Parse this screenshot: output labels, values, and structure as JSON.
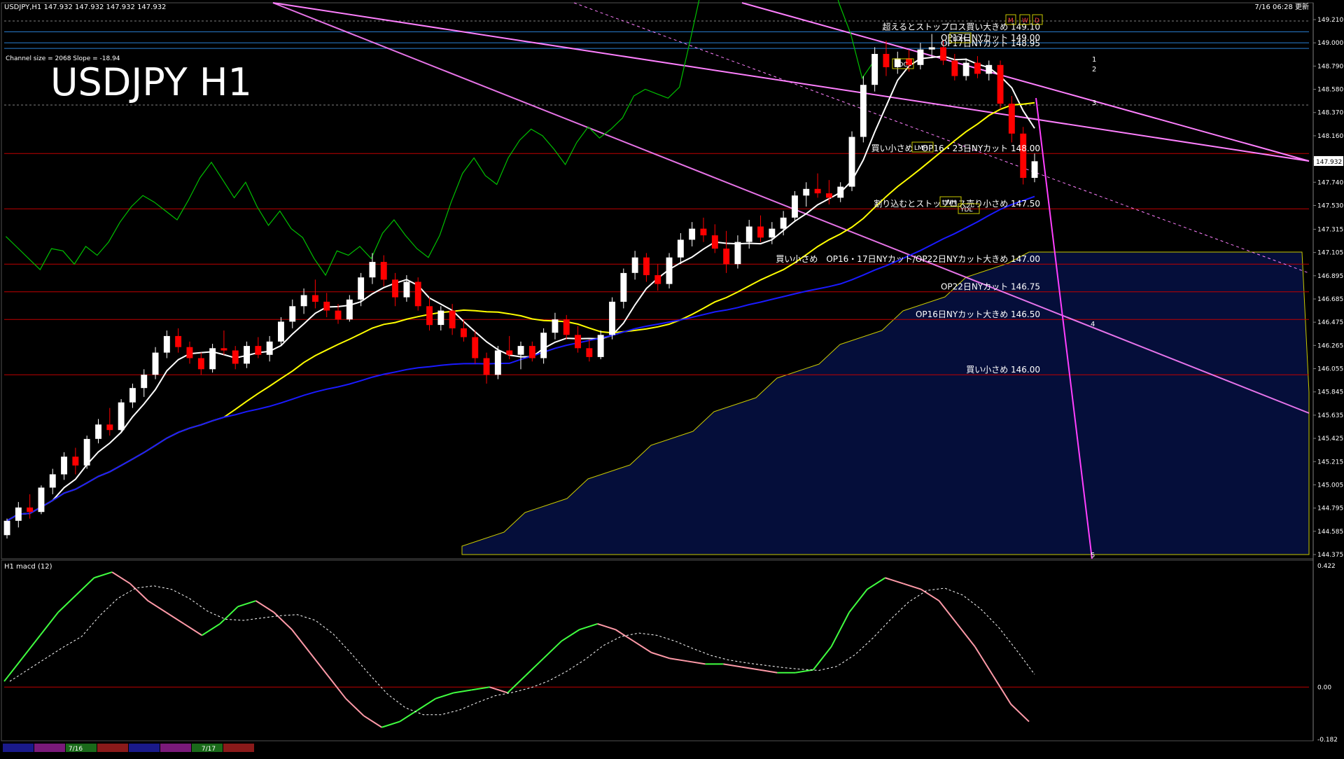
{
  "header": {
    "symbol_line": "USDJPY,H1  147.932 147.932 147.932 147.932",
    "updated": "7/16 06:28 更新",
    "channel_info": "Channel size = 2068 Slope = -18.94",
    "big_title": "USDJPY H1"
  },
  "colors": {
    "background": "#000000",
    "bull_candle": "#ffffff",
    "bear_candle": "#ff0000",
    "ma_fast": "#ffffff",
    "ma_mid": "#ffff00",
    "ma_slow": "#1a1aff",
    "chikou": "#00c000",
    "channel": "#ff80ff",
    "level_line": "#c00000",
    "macd_up": "#40ff40",
    "macd_down": "#ff9aa8"
  },
  "chart_data": {
    "type": "line",
    "symbol": "USDJPY",
    "timeframe": "H1",
    "ylim": [
      144.375,
      149.21
    ],
    "y_ticks": [
      "149.210",
      "149.000",
      "148.790",
      "148.580",
      "148.370",
      "148.160",
      "147.950",
      "147.740",
      "147.530",
      "147.315",
      "147.105",
      "146.895",
      "146.685",
      "146.475",
      "146.265",
      "146.055",
      "145.845",
      "145.635",
      "145.425",
      "145.215",
      "145.005",
      "144.795",
      "144.585",
      "144.375"
    ],
    "current_price": "147.932",
    "x_labels": [
      "7/16",
      "7/17"
    ],
    "annotations": [
      {
        "text": "超えるとストップロス買い大きめ 149.10",
        "price": 149.1
      },
      {
        "text": "OP17日NYカット 149.00",
        "price": 149.0
      },
      {
        "text": "OP17日NYカット 148.95",
        "price": 148.95
      },
      {
        "text": "買い小さめ　OP16・23日NYカット 148.00",
        "price": 148.0
      },
      {
        "text": "割り込むとストップロス売り小さめ 147.50",
        "price": 147.5
      },
      {
        "text": "買い小さめ　OP16・17日NYカット/OP22日NYカット大きめ 147.00",
        "price": 147.0
      },
      {
        "text": "OP22日NYカット 146.75",
        "price": 146.75
      },
      {
        "text": "OP16日NYカット大きめ 146.50",
        "price": 146.5
      },
      {
        "text": "買い小さめ 146.00",
        "price": 146.0
      }
    ],
    "level_lines": [
      149.1,
      149.0,
      148.95,
      148.0,
      147.5,
      147.0,
      146.75,
      146.5,
      146.0
    ],
    "markers": [
      "YDC",
      "YDH",
      "YDL",
      "LWH",
      "LMH",
      "M",
      "W",
      "D"
    ],
    "projection_labels": [
      "1",
      "2",
      "3",
      "4",
      "5"
    ],
    "candles": [
      [
        144.55,
        144.7,
        144.52,
        144.68
      ],
      [
        144.68,
        144.85,
        144.62,
        144.8
      ],
      [
        144.8,
        144.92,
        144.7,
        144.76
      ],
      [
        144.76,
        145.0,
        144.74,
        144.98
      ],
      [
        144.98,
        145.15,
        144.92,
        145.1
      ],
      [
        145.1,
        145.3,
        145.05,
        145.26
      ],
      [
        145.26,
        145.34,
        145.1,
        145.18
      ],
      [
        145.18,
        145.45,
        145.15,
        145.42
      ],
      [
        145.42,
        145.6,
        145.38,
        145.55
      ],
      [
        145.55,
        145.7,
        145.45,
        145.5
      ],
      [
        145.5,
        145.78,
        145.48,
        145.75
      ],
      [
        145.75,
        145.92,
        145.7,
        145.88
      ],
      [
        145.88,
        146.05,
        145.8,
        146.0
      ],
      [
        146.0,
        146.25,
        145.96,
        146.2
      ],
      [
        146.2,
        146.4,
        146.15,
        146.35
      ],
      [
        146.35,
        146.42,
        146.2,
        146.25
      ],
      [
        146.25,
        146.3,
        146.1,
        146.15
      ],
      [
        146.15,
        146.2,
        146.0,
        146.05
      ],
      [
        146.05,
        146.28,
        146.02,
        146.24
      ],
      [
        146.24,
        146.4,
        146.18,
        146.22
      ],
      [
        146.22,
        146.26,
        146.05,
        146.1
      ],
      [
        146.1,
        146.3,
        146.06,
        146.26
      ],
      [
        146.26,
        146.34,
        146.15,
        146.18
      ],
      [
        146.18,
        146.35,
        146.12,
        146.3
      ],
      [
        146.3,
        146.52,
        146.26,
        146.48
      ],
      [
        146.48,
        146.68,
        146.42,
        146.62
      ],
      [
        146.62,
        146.78,
        146.55,
        146.72
      ],
      [
        146.72,
        146.86,
        146.6,
        146.66
      ],
      [
        146.66,
        146.74,
        146.52,
        146.58
      ],
      [
        146.58,
        146.64,
        146.46,
        146.5
      ],
      [
        146.5,
        146.72,
        146.48,
        146.68
      ],
      [
        146.68,
        146.92,
        146.62,
        146.88
      ],
      [
        146.88,
        147.1,
        146.82,
        147.02
      ],
      [
        147.02,
        147.08,
        146.8,
        146.86
      ],
      [
        146.86,
        146.92,
        146.62,
        146.7
      ],
      [
        146.7,
        146.9,
        146.66,
        146.84
      ],
      [
        146.84,
        146.88,
        146.58,
        146.62
      ],
      [
        146.62,
        146.7,
        146.4,
        146.45
      ],
      [
        146.45,
        146.62,
        146.4,
        146.58
      ],
      [
        146.58,
        146.64,
        146.36,
        146.42
      ],
      [
        146.42,
        146.5,
        146.3,
        146.34
      ],
      [
        146.34,
        146.4,
        146.1,
        146.15
      ],
      [
        146.15,
        146.2,
        145.92,
        146.0
      ],
      [
        146.0,
        146.26,
        145.96,
        146.22
      ],
      [
        146.22,
        146.35,
        146.14,
        146.18
      ],
      [
        146.18,
        146.3,
        146.05,
        146.26
      ],
      [
        146.26,
        146.3,
        146.12,
        146.15
      ],
      [
        146.15,
        146.42,
        146.1,
        146.38
      ],
      [
        146.38,
        146.56,
        146.32,
        146.5
      ],
      [
        146.5,
        146.54,
        146.32,
        146.36
      ],
      [
        146.36,
        146.44,
        146.2,
        146.24
      ],
      [
        146.24,
        146.32,
        146.12,
        146.16
      ],
      [
        146.16,
        146.4,
        146.14,
        146.36
      ],
      [
        146.36,
        146.7,
        146.32,
        146.66
      ],
      [
        146.66,
        146.96,
        146.6,
        146.92
      ],
      [
        146.92,
        147.12,
        146.86,
        147.06
      ],
      [
        147.06,
        147.1,
        146.84,
        146.9
      ],
      [
        146.9,
        147.0,
        146.76,
        146.82
      ],
      [
        146.82,
        147.1,
        146.78,
        147.06
      ],
      [
        147.06,
        147.28,
        147.0,
        147.22
      ],
      [
        147.22,
        147.38,
        147.16,
        147.32
      ],
      [
        147.32,
        147.42,
        147.2,
        147.26
      ],
      [
        147.26,
        147.36,
        147.1,
        147.14
      ],
      [
        147.14,
        147.3,
        146.92,
        147.0
      ],
      [
        147.0,
        147.26,
        146.96,
        147.2
      ],
      [
        147.2,
        147.4,
        147.14,
        147.34
      ],
      [
        147.34,
        147.44,
        147.2,
        147.24
      ],
      [
        147.24,
        147.38,
        147.18,
        147.32
      ],
      [
        147.32,
        147.48,
        147.26,
        147.42
      ],
      [
        147.42,
        147.66,
        147.38,
        147.62
      ],
      [
        147.62,
        147.74,
        147.52,
        147.68
      ],
      [
        147.68,
        147.82,
        147.6,
        147.64
      ],
      [
        147.64,
        147.76,
        147.54,
        147.6
      ],
      [
        147.6,
        147.74,
        147.56,
        147.7
      ],
      [
        147.7,
        148.2,
        147.66,
        148.15
      ],
      [
        148.15,
        148.7,
        148.1,
        148.62
      ],
      [
        148.62,
        148.96,
        148.56,
        148.9
      ],
      [
        148.9,
        149.02,
        148.7,
        148.78
      ],
      [
        148.78,
        148.92,
        148.72,
        148.86
      ],
      [
        148.86,
        148.94,
        148.74,
        148.8
      ],
      [
        148.8,
        149.0,
        148.76,
        148.94
      ],
      [
        148.94,
        149.08,
        148.86,
        148.96
      ],
      [
        148.96,
        149.02,
        148.8,
        148.84
      ],
      [
        148.84,
        148.9,
        148.66,
        148.7
      ],
      [
        148.7,
        148.86,
        148.66,
        148.82
      ],
      [
        148.82,
        148.88,
        148.68,
        148.72
      ],
      [
        148.72,
        148.84,
        148.66,
        148.8
      ],
      [
        148.8,
        148.84,
        148.4,
        148.45
      ],
      [
        148.45,
        148.52,
        148.1,
        148.18
      ],
      [
        148.18,
        148.24,
        147.72,
        147.78
      ],
      [
        147.78,
        148.0,
        147.74,
        147.93
      ]
    ],
    "macd_ylim": [
      -0.182,
      0.422
    ],
    "macd_ticks": [
      "0.422",
      "0.00",
      "-0.182"
    ],
    "macd_label": "H1  macd (12)",
    "macd_main": [
      0.02,
      0.1,
      0.18,
      0.26,
      0.32,
      0.38,
      0.4,
      0.36,
      0.3,
      0.26,
      0.22,
      0.18,
      0.22,
      0.28,
      0.3,
      0.26,
      0.2,
      0.12,
      0.04,
      -0.04,
      -0.1,
      -0.14,
      -0.12,
      -0.08,
      -0.04,
      -0.02,
      -0.01,
      0.0,
      -0.02,
      0.04,
      0.1,
      0.16,
      0.2,
      0.22,
      0.2,
      0.16,
      0.12,
      0.1,
      0.09,
      0.08,
      0.08,
      0.07,
      0.06,
      0.05,
      0.05,
      0.06,
      0.14,
      0.26,
      0.34,
      0.38,
      0.36,
      0.34,
      0.3,
      0.22,
      0.14,
      0.04,
      -0.06,
      -0.12
    ]
  }
}
